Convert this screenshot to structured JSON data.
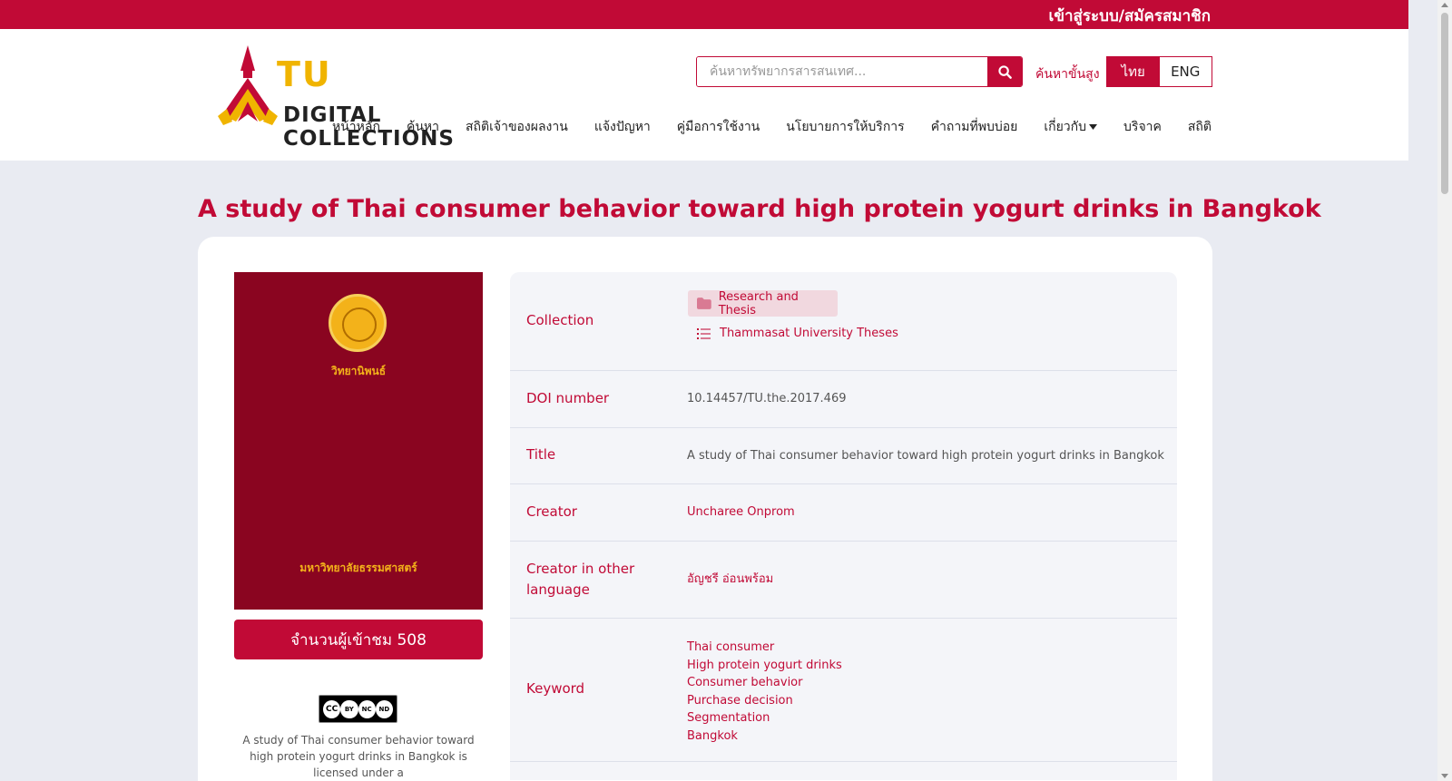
{
  "topbar": {
    "login_label": "เข้าสู่ระบบ/สมัครสมาชิก"
  },
  "logo": {
    "brand": "TU",
    "name": "DIGITAL COLLECTIONS"
  },
  "search": {
    "placeholder": "ค้นหาทรัพยากรสารสนเทศ...",
    "value": "",
    "advanced_label": "ค้นหาขั้นสูง"
  },
  "lang": {
    "thai": "ไทย",
    "english": "ENG",
    "active": "ไทย"
  },
  "nav": [
    {
      "label": "หน้าหลัก"
    },
    {
      "label": "ค้นหา"
    },
    {
      "label": "สถิติเจ้าของผลงาน"
    },
    {
      "label": "แจ้งปัญหา"
    },
    {
      "label": "คู่มือการใช้งาน"
    },
    {
      "label": "นโยบายการให้บริการ"
    },
    {
      "label": "คำถามที่พบบ่อย"
    },
    {
      "label": "เกี่ยวกับ"
    },
    {
      "label": "บริจาค"
    },
    {
      "label": "สถิติ"
    }
  ],
  "page": {
    "title": "A study of Thai consumer behavior toward high protein yogurt drinks in Bangkok"
  },
  "cover": {
    "line1": "วิทยานิพนธ์",
    "line2": "มหาวิทยาลัยธรรมศาสตร์"
  },
  "views": {
    "label": "จำนวนผู้เข้าชม 508"
  },
  "license": {
    "badge": [
      "CC",
      "BY",
      "NC",
      "ND"
    ],
    "text": "A study of Thai consumer behavior toward high protein yogurt drinks in Bangkok is licensed under a"
  },
  "metadata": {
    "collection": {
      "label": "Collection",
      "community": "Research and Thesis",
      "collection": "Thammasat University Theses"
    },
    "doi": {
      "label": "DOI number",
      "value": "10.14457/TU.the.2017.469"
    },
    "title": {
      "label": "Title",
      "value": "A study of Thai consumer behavior toward high protein yogurt drinks in Bangkok"
    },
    "creator": {
      "label": "Creator",
      "value": "Uncharee Onprom"
    },
    "creator_other": {
      "label": "Creator in other language",
      "value": "อัญชรี อ่อนพร้อม"
    },
    "keyword": {
      "label": "Keyword",
      "values": [
        "Thai consumer",
        "High protein yogurt drinks",
        "Consumer behavior",
        "Purchase decision",
        "Segmentation",
        "Bangkok"
      ]
    }
  },
  "colors": {
    "brand": "#c10a36",
    "gold": "#f0b400",
    "cover": "#8a0520"
  }
}
